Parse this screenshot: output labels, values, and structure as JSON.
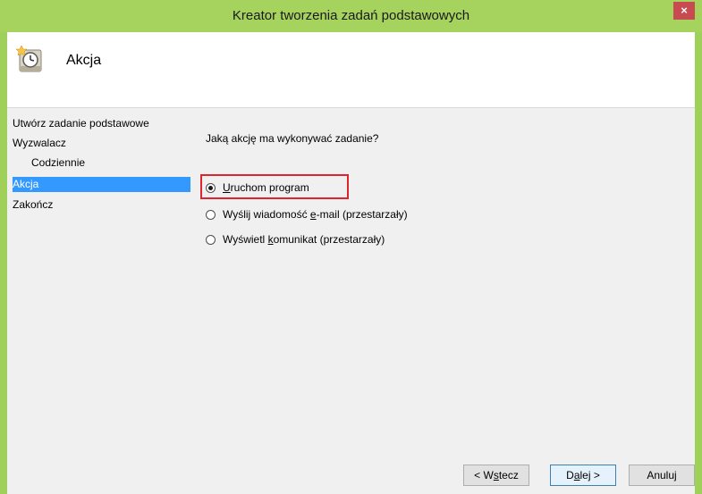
{
  "window": {
    "title": "Kreator tworzenia zadań podstawowych",
    "close_glyph": "×"
  },
  "header": {
    "title": "Akcja",
    "icon": "task-scheduler-icon"
  },
  "sidebar": {
    "items": [
      {
        "label": "Utwórz zadanie podstawowe"
      },
      {
        "label": "Wyzwalacz"
      },
      {
        "label": "Codziennie"
      },
      {
        "label": "Akcja"
      },
      {
        "label": "Zakończ"
      }
    ]
  },
  "main": {
    "question": "Jaką akcję ma wykonywać zadanie?",
    "options": [
      {
        "pre": "",
        "key": "U",
        "post": "ruchom program",
        "checked": true
      },
      {
        "pre": "Wyślij wiadomość ",
        "key": "e",
        "post": "-mail (przestarzały)",
        "checked": false
      },
      {
        "pre": "Wyświetl ",
        "key": "k",
        "post": "omunikat (przestarzały)",
        "checked": false
      }
    ]
  },
  "buttons": {
    "back": {
      "pre": "< W",
      "key": "s",
      "post": "tecz"
    },
    "next": {
      "pre": "D",
      "key": "a",
      "post": "lej >"
    },
    "cancel": {
      "label": "Anuluj"
    }
  },
  "colors": {
    "frame": "#9fd15a",
    "selection": "#3399ff",
    "highlight_border": "#e0242f",
    "close_button": "#c74b50"
  }
}
